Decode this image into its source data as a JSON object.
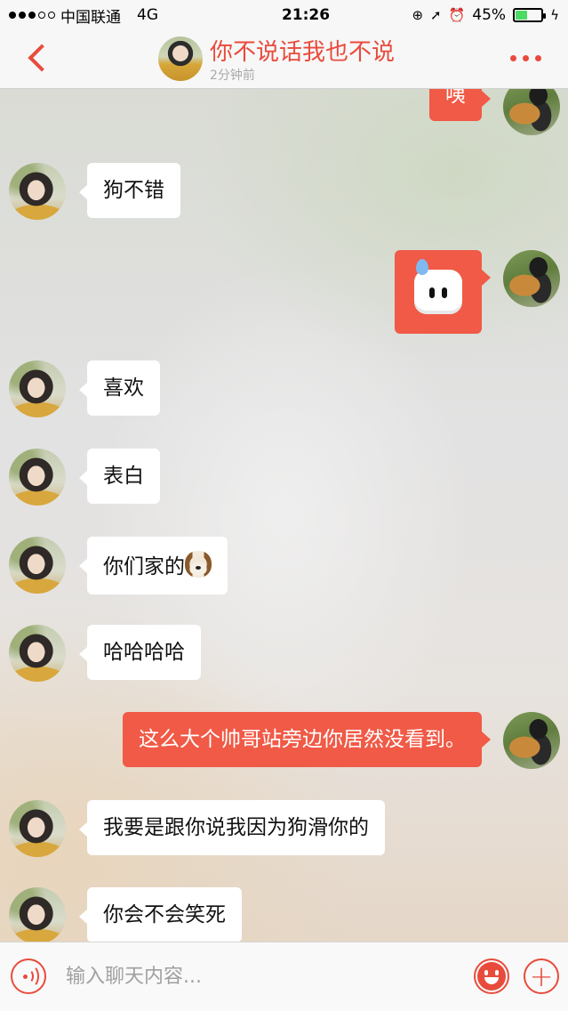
{
  "status_bar": {
    "carrier": "中国联通",
    "network": "4G",
    "time": "21:26",
    "battery": "45%",
    "battery_level": 0.45,
    "signal_bars_filled": 3,
    "signal_bars_total": 5
  },
  "header": {
    "title": "你不说话我也不说",
    "subtitle": "2分钟前"
  },
  "messages": [
    {
      "side": "out",
      "text": "咦"
    },
    {
      "side": "in",
      "text": "狗不错"
    },
    {
      "side": "out",
      "text": "",
      "sticker": "sweat-face-emoji"
    },
    {
      "side": "in",
      "text": "喜欢"
    },
    {
      "side": "in",
      "text": "表白"
    },
    {
      "side": "in",
      "text": "你们家的",
      "trailing_emoji": "dog-face-emoji"
    },
    {
      "side": "in",
      "text": "哈哈哈哈"
    },
    {
      "side": "out",
      "text": "这么大个帅哥站旁边你居然没看到。"
    },
    {
      "side": "in",
      "text": "我要是跟你说我因为狗滑你的"
    },
    {
      "side": "in",
      "text": "你会不会笑死"
    }
  ],
  "input_bar": {
    "placeholder": "输入聊天内容..."
  },
  "colors": {
    "accent": "#e84b3c",
    "outgoing_bubble": "#f05a46",
    "incoming_bubble": "#ffffff"
  }
}
